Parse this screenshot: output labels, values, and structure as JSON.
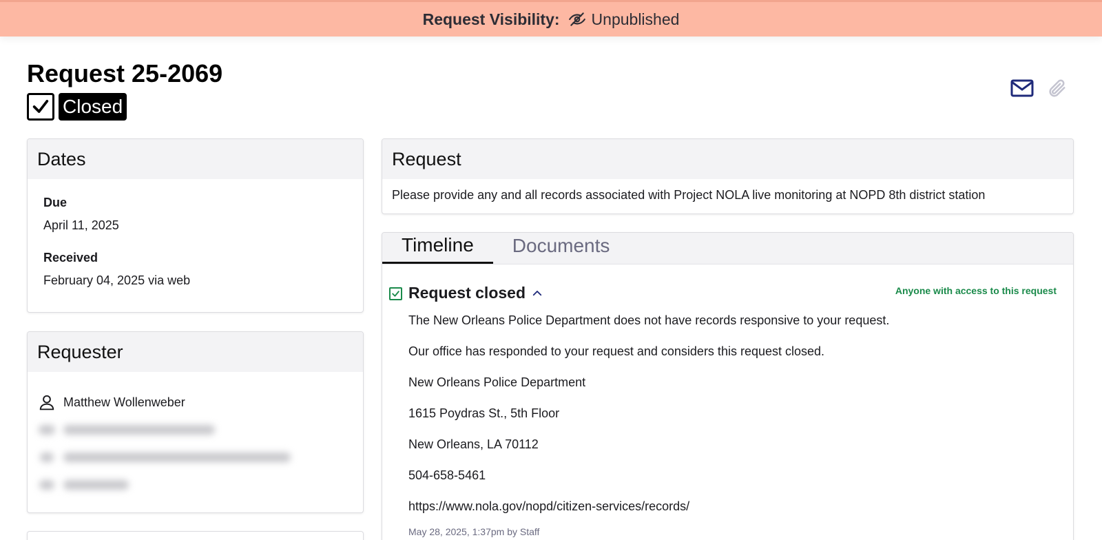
{
  "banner": {
    "label": "Request Visibility:",
    "value": "Unpublished",
    "icon": "eye-slash-icon",
    "color": "#fdb8a3"
  },
  "header": {
    "title": "Request 25-2069",
    "status": "Closed",
    "actions": [
      {
        "name": "email-icon",
        "color": "#1f2a7a"
      },
      {
        "name": "paperclip-icon",
        "color": "#c4c4d0"
      }
    ]
  },
  "dates": {
    "heading": "Dates",
    "due_label": "Due",
    "due_value": "April 11, 2025",
    "received_label": "Received",
    "received_value": "February 04, 2025 via web"
  },
  "requester": {
    "heading": "Requester",
    "name": "Matthew Wollenweber"
  },
  "request": {
    "heading": "Request",
    "text": "Please provide any and all records associated with Project NOLA live monitoring at NOPD 8th district station"
  },
  "tabs": [
    {
      "label": "Timeline",
      "active": true
    },
    {
      "label": "Documents",
      "active": false
    }
  ],
  "timeline": {
    "event_title": "Request closed",
    "access": "Anyone with access to this request",
    "lines": [
      "The New Orleans Police Department does not have records responsive to your request.",
      "Our office has responded to your request and considers this request closed.",
      "New Orleans Police Department",
      "1615 Poydras St., 5th Floor",
      "New Orleans, LA 70112",
      "504-658-5461",
      "https://www.nola.gov/nopd/citizen-services/records/"
    ],
    "meta": "May 28, 2025, 1:37pm by Staff",
    "status_color": "#1a8a4a"
  }
}
